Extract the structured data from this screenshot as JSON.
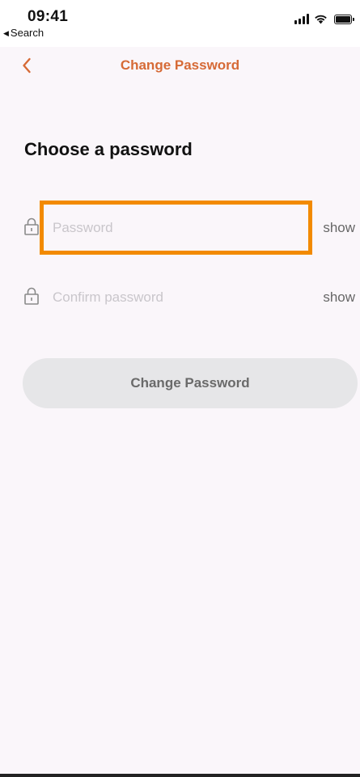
{
  "status_bar": {
    "time": "09:41",
    "back_app": "Search",
    "icons": [
      "signal-icon",
      "wifi-icon",
      "battery-icon"
    ]
  },
  "nav": {
    "back_icon": "chevron-left-icon",
    "title": "Change Password"
  },
  "form": {
    "heading": "Choose a password",
    "password": {
      "placeholder": "Password",
      "value": "",
      "toggle_label": "show",
      "icon": "lock-icon"
    },
    "confirm_password": {
      "placeholder": "Confirm password",
      "value": "",
      "toggle_label": "show",
      "icon": "lock-icon"
    },
    "submit_label": "Change Password"
  },
  "colors": {
    "accent": "#d66a36",
    "highlight": "#f28a00",
    "background": "#faf6fa",
    "button_bg": "#e6e6e8",
    "button_text": "#6a6a6a",
    "placeholder": "#c9c6cb"
  }
}
